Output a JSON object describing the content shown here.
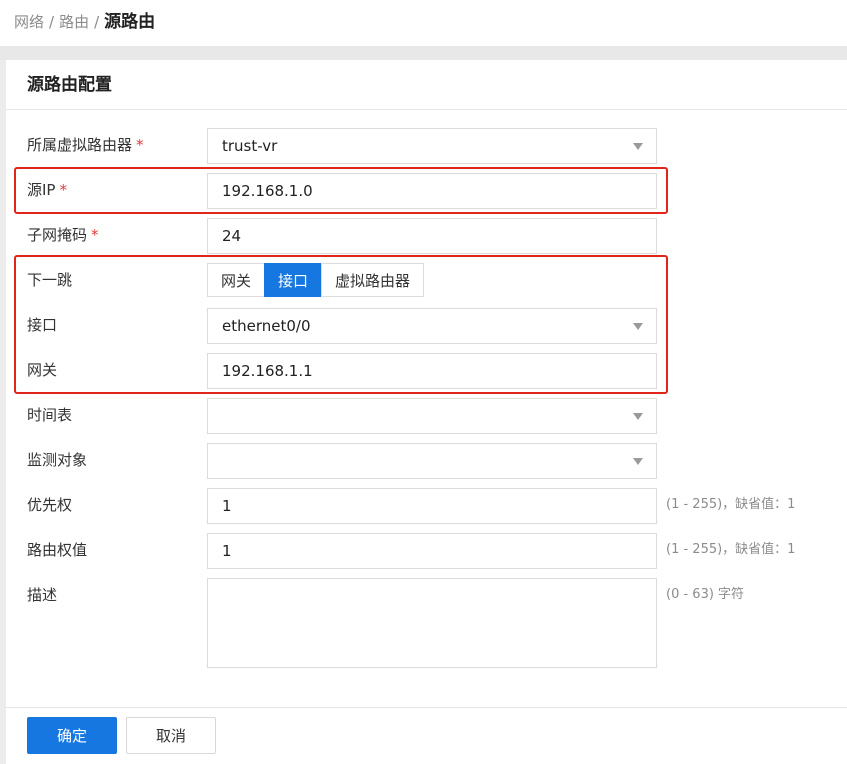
{
  "breadcrumb": {
    "items": [
      "网络",
      "路由"
    ],
    "separator": "/",
    "current": "源路由"
  },
  "card": {
    "title": "源路由配置"
  },
  "form": {
    "required_mark": "*",
    "virtual_router": {
      "label": "所属虚拟路由器",
      "value": "trust-vr"
    },
    "source_ip": {
      "label": "源IP",
      "value": "192.168.1.0"
    },
    "subnet_mask": {
      "label": "子网掩码",
      "value": "24"
    },
    "next_hop": {
      "label": "下一跳",
      "options": [
        "网关",
        "接口",
        "虚拟路由器"
      ],
      "selected": "接口"
    },
    "interface": {
      "label": "接口",
      "value": "ethernet0/0"
    },
    "gateway": {
      "label": "网关",
      "value": "192.168.1.1"
    },
    "schedule": {
      "label": "时间表",
      "value": ""
    },
    "track_object": {
      "label": "监测对象",
      "value": ""
    },
    "priority": {
      "label": "优先权",
      "value": "1",
      "hint": "(1 - 255)，缺省值：1"
    },
    "route_weight": {
      "label": "路由权值",
      "value": "1",
      "hint": "(1 - 255)，缺省值：1"
    },
    "description": {
      "label": "描述",
      "value": "",
      "hint": "(0 - 63) 字符"
    }
  },
  "actions": {
    "confirm": "确定",
    "cancel": "取消"
  },
  "colors": {
    "primary": "#1677e0",
    "highlight_box": "#e0251b",
    "required": "#e23d3d"
  },
  "icons": {
    "dropdown": "chevron-down-icon"
  }
}
